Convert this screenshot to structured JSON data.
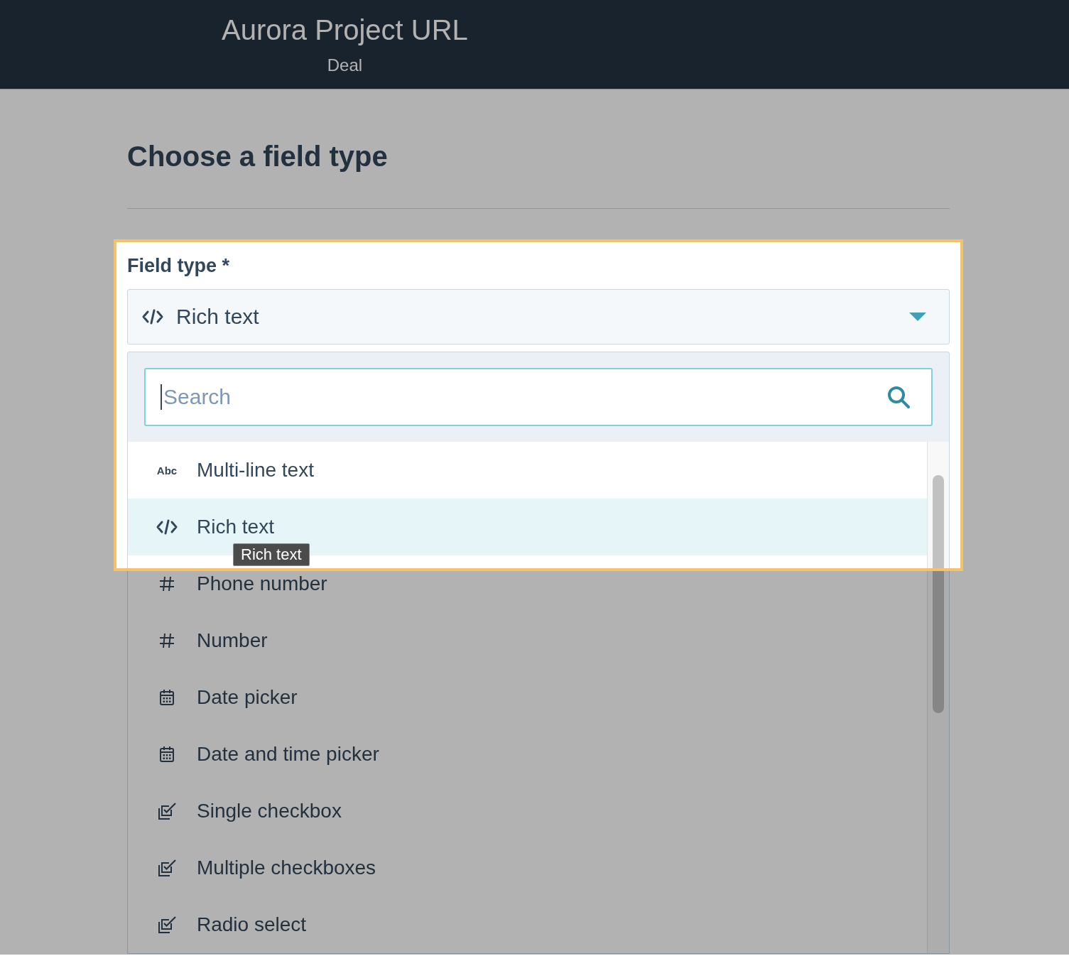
{
  "header": {
    "title": "Aurora Project URL",
    "subtitle": "Deal"
  },
  "page_title": "Choose a field type",
  "field": {
    "label": "Field type *",
    "selected_option": {
      "label": "Rich text",
      "kind": "code"
    },
    "expanded": true,
    "highlighted": true
  },
  "dropdown": {
    "search": {
      "placeholder": "Search"
    },
    "items": [
      {
        "label": "Multi-line text",
        "kind": "text",
        "icon_text": "Abc",
        "selected": false
      },
      {
        "label": "Rich text",
        "kind": "code",
        "selected": true,
        "tooltip": "Rich text"
      },
      {
        "label": "Phone number",
        "kind": "hash",
        "selected": false
      },
      {
        "label": "Number",
        "kind": "hash",
        "selected": false
      },
      {
        "label": "Date picker",
        "kind": "calendar",
        "selected": false
      },
      {
        "label": "Date and time picker",
        "kind": "calendar",
        "selected": false
      },
      {
        "label": "Single checkbox",
        "kind": "checkbox",
        "selected": false
      },
      {
        "label": "Multiple checkboxes",
        "kind": "checkbox",
        "selected": false
      },
      {
        "label": "Radio select",
        "kind": "checkbox",
        "selected": false
      }
    ]
  }
}
